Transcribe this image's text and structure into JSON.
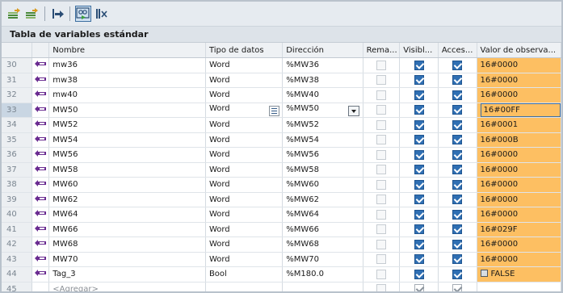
{
  "toolbar": {
    "buttons": [
      {
        "icon": "insert-row-icon"
      },
      {
        "icon": "add-row-icon"
      },
      {
        "icon": "export-icon"
      },
      {
        "icon": "monitor-all-icon",
        "active": true
      },
      {
        "icon": "delete-icon"
      }
    ]
  },
  "table_title": "Tabla de variables estándar",
  "columns": {
    "nombre": "Nombre",
    "tipo": "Tipo de datos",
    "direccion": "Dirección",
    "remanencia": "Rema...",
    "visible": "Visibl...",
    "accesible": "Acces...",
    "valor": "Valor de observa..."
  },
  "rows": [
    {
      "num": "30",
      "name": "mw36",
      "type": "Word",
      "addr": "%MW36",
      "value": "16#0000"
    },
    {
      "num": "31",
      "name": "mw38",
      "type": "Word",
      "addr": "%MW38",
      "value": "16#0000"
    },
    {
      "num": "32",
      "name": "mw40",
      "type": "Word",
      "addr": "%MW40",
      "value": "16#0000"
    },
    {
      "num": "33",
      "name": "MW50",
      "type": "Word",
      "addr": "%MW50",
      "value": "16#00FF"
    },
    {
      "num": "34",
      "name": "MW52",
      "type": "Word",
      "addr": "%MW52",
      "value": "16#0001"
    },
    {
      "num": "35",
      "name": "MW54",
      "type": "Word",
      "addr": "%MW54",
      "value": "16#000B"
    },
    {
      "num": "36",
      "name": "MW56",
      "type": "Word",
      "addr": "%MW56",
      "value": "16#0000"
    },
    {
      "num": "37",
      "name": "MW58",
      "type": "Word",
      "addr": "%MW58",
      "value": "16#0000"
    },
    {
      "num": "38",
      "name": "MW60",
      "type": "Word",
      "addr": "%MW60",
      "value": "16#0000"
    },
    {
      "num": "39",
      "name": "MW62",
      "type": "Word",
      "addr": "%MW62",
      "value": "16#0000"
    },
    {
      "num": "40",
      "name": "MW64",
      "type": "Word",
      "addr": "%MW64",
      "value": "16#0000"
    },
    {
      "num": "41",
      "name": "MW66",
      "type": "Word",
      "addr": "%MW66",
      "value": "16#029F"
    },
    {
      "num": "42",
      "name": "MW68",
      "type": "Word",
      "addr": "%MW68",
      "value": "16#0000"
    },
    {
      "num": "43",
      "name": "MW70",
      "type": "Word",
      "addr": "%MW70",
      "value": "16#0000"
    },
    {
      "num": "44",
      "name": "Tag_3",
      "type": "Bool",
      "addr": "%M180.0",
      "value": "FALSE"
    }
  ],
  "add_row": {
    "num": "45",
    "placeholder": "<Agregar>"
  },
  "selected_row": "33",
  "colors": {
    "monitor_bg": "#fdbf62",
    "checkbox_on": "#2f6fb3",
    "selection_border": "#3c6ea3",
    "tag_icon": "#6a2c91"
  }
}
